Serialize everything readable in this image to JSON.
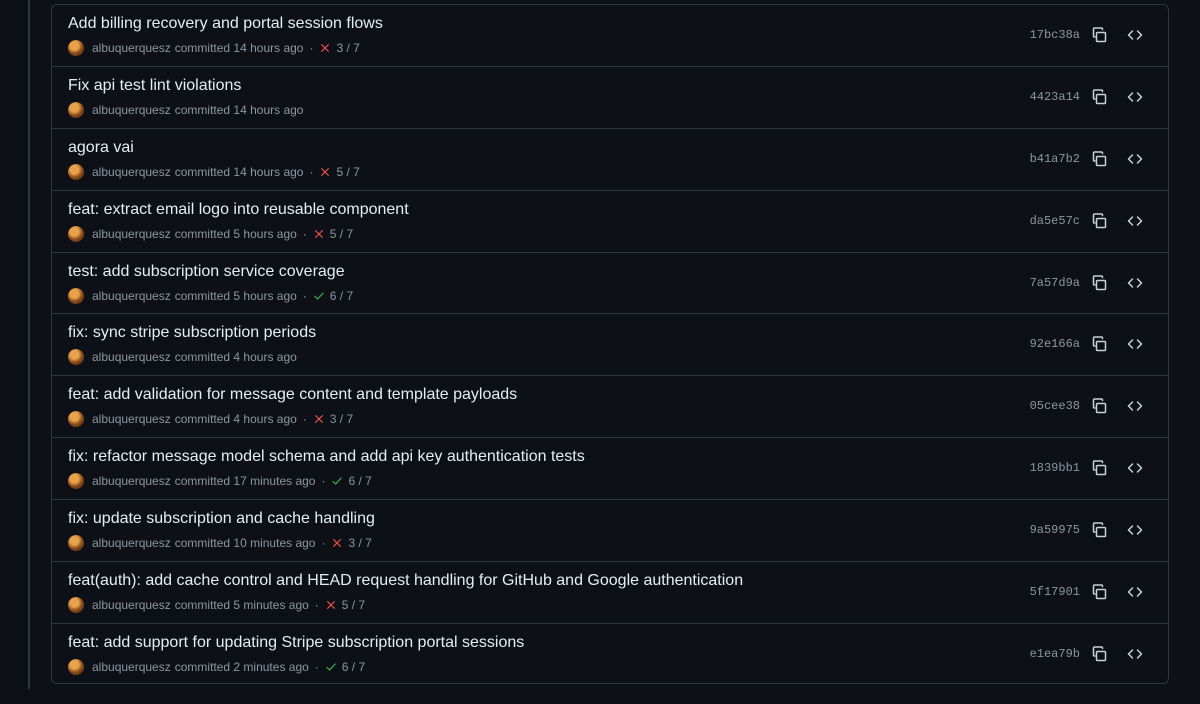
{
  "commits": [
    {
      "title": "Add billing recovery and portal session flows",
      "author": "albuquerquesz",
      "time": "committed 14 hours ago",
      "status": "fail",
      "checks": "3 / 7",
      "sha": "17bc38a"
    },
    {
      "title": "Fix api test lint violations",
      "author": "albuquerquesz",
      "time": "committed 14 hours ago",
      "status": "none",
      "checks": "",
      "sha": "4423a14"
    },
    {
      "title": "agora vai",
      "author": "albuquerquesz",
      "time": "committed 14 hours ago",
      "status": "fail",
      "checks": "5 / 7",
      "sha": "b41a7b2"
    },
    {
      "title": "feat: extract email logo into reusable component",
      "author": "albuquerquesz",
      "time": "committed 5 hours ago",
      "status": "fail",
      "checks": "5 / 7",
      "sha": "da5e57c"
    },
    {
      "title": "test: add subscription service coverage",
      "author": "albuquerquesz",
      "time": "committed 5 hours ago",
      "status": "pass",
      "checks": "6 / 7",
      "sha": "7a57d9a"
    },
    {
      "title": "fix: sync stripe subscription periods",
      "author": "albuquerquesz",
      "time": "committed 4 hours ago",
      "status": "none",
      "checks": "",
      "sha": "92e166a"
    },
    {
      "title": "feat: add validation for message content and template payloads",
      "author": "albuquerquesz",
      "time": "committed 4 hours ago",
      "status": "fail",
      "checks": "3 / 7",
      "sha": "05cee38"
    },
    {
      "title": "fix: refactor message model schema and add api key authentication tests",
      "author": "albuquerquesz",
      "time": "committed 17 minutes ago",
      "status": "pass",
      "checks": "6 / 7",
      "sha": "1839bb1"
    },
    {
      "title": "fix: update subscription and cache handling",
      "author": "albuquerquesz",
      "time": "committed 10 minutes ago",
      "status": "fail",
      "checks": "3 / 7",
      "sha": "9a59975"
    },
    {
      "title": "feat(auth): add cache control and HEAD request handling for GitHub and Google authentication",
      "author": "albuquerquesz",
      "time": "committed 5 minutes ago",
      "status": "fail",
      "checks": "5 / 7",
      "sha": "5f17901"
    },
    {
      "title": "feat: add support for updating Stripe subscription portal sessions",
      "author": "albuquerquesz",
      "time": "committed 2 minutes ago",
      "status": "pass",
      "checks": "6 / 7",
      "sha": "e1ea79b"
    }
  ],
  "icons": {
    "copy": "copy-icon",
    "browse": "code-icon",
    "fail": "x-icon",
    "pass": "check-icon"
  },
  "colors": {
    "background": "#0d1117",
    "border": "#30363d",
    "title": "#e6edf3",
    "muted": "#8d96a0",
    "fail": "#f85149",
    "pass": "#3fb950"
  }
}
